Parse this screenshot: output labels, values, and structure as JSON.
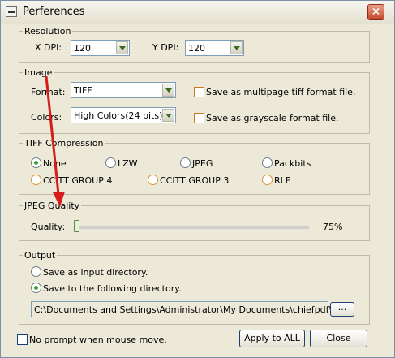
{
  "window": {
    "title": "Perferences",
    "close_glyph": "✕"
  },
  "resolution": {
    "legend": "Resolution",
    "xdpi_label": "X DPI:",
    "xdpi_value": "120",
    "ydpi_label": "Y DPI:",
    "ydpi_value": "120"
  },
  "image": {
    "legend": "Image",
    "format_label": "Format:",
    "format_value": "TIFF",
    "colors_label": "Colors:",
    "colors_value": "High Colors(24 bits)",
    "multipage_label": "Save as multipage tiff format file.",
    "grayscale_label": "Save as grayscale format file."
  },
  "tiff": {
    "legend": "TIFF Compression",
    "options": [
      "None",
      "LZW",
      "JPEG",
      "Packbits",
      "CCITT GROUP 4",
      "CCITT GROUP 3",
      "RLE"
    ],
    "selected": "None"
  },
  "jpeg": {
    "legend": "JPEG Quality",
    "quality_label": "Quality:",
    "quality_value": "75%",
    "slider_level": 0
  },
  "output": {
    "legend": "Output",
    "opt_input": "Save as input directory.",
    "opt_following": "Save to the following directory.",
    "selected": "following",
    "directory": "C:\\Documents and Settings\\Administrator\\My Documents\\chiefpdf\\",
    "browse_label": "..."
  },
  "footer": {
    "no_prompt_label": "No prompt when mouse move.",
    "apply_label": "Apply to ALL",
    "close_label": "Close"
  },
  "colors": {
    "annotation_arrow": "#d71c1c",
    "radio_selected": "#2fa82f"
  }
}
